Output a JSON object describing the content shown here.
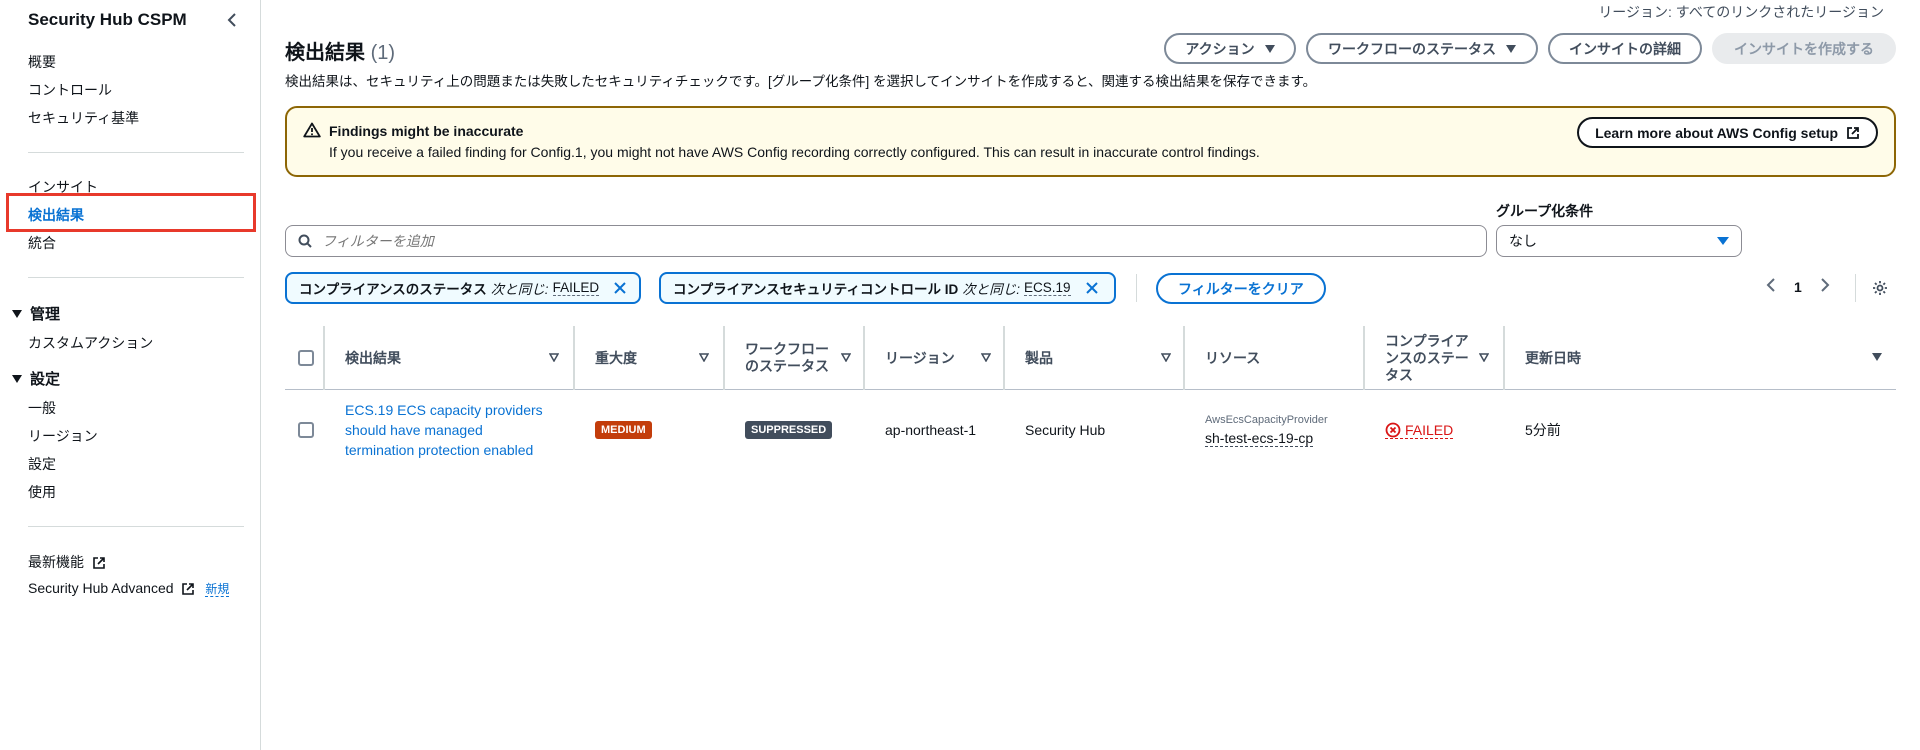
{
  "sidebar": {
    "title": "Security Hub CSPM",
    "nav1": [
      "概要",
      "コントロール",
      "セキュリティ基準"
    ],
    "nav2": [
      "インサイト",
      "検出結果",
      "統合"
    ],
    "section_manage": "管理",
    "manage_items": [
      "カスタムアクション"
    ],
    "section_settings": "設定",
    "settings_items": [
      "一般",
      "リージョン",
      "設定",
      "使用"
    ],
    "latest": "最新機能",
    "advanced": "Security Hub Advanced",
    "new_badge": "新規"
  },
  "header": {
    "region": "リージョン: すべてのリンクされたリージョン",
    "title": "検出結果",
    "count": "(1)",
    "description": "検出結果は、セキュリティ上の問題または失敗したセキュリティチェックです。[グループ化条件] を選択してインサイトを作成すると、関連する検出結果を保存できます。",
    "actions_label": "アクション",
    "workflow_label": "ワークフローのステータス",
    "insight_detail_label": "インサイトの詳細",
    "create_insight_label": "インサイトを作成する"
  },
  "alert": {
    "title": "Findings might be inaccurate",
    "text": "If you receive a failed finding for Config.1, you might not have AWS Config recording correctly configured. This can result in inaccurate control findings.",
    "button": "Learn more about AWS Config setup"
  },
  "filter": {
    "placeholder": "フィルターを追加",
    "group_label": "グループ化条件",
    "group_value": "なし",
    "tokens": [
      {
        "key": "コンプライアンスのステータス",
        "op": "次と同じ:",
        "value": "FAILED"
      },
      {
        "key": "コンプライアンスセキュリティコントロール ID",
        "op": "次と同じ:",
        "value": "ECS.19"
      }
    ],
    "clear": "フィルターをクリア",
    "page": "1"
  },
  "table": {
    "headers": {
      "finding": "検出結果",
      "severity": "重大度",
      "workflow1": "ワークフロー",
      "workflow2": "のステータス",
      "region": "リージョン",
      "product": "製品",
      "resource": "リソース",
      "compliance1": "コンプライア",
      "compliance2": "ンスのステー",
      "compliance3": "タス",
      "updated": "更新日時"
    },
    "rows": [
      {
        "title1": "ECS.19 ECS capacity providers",
        "title2": "should have managed",
        "title3": "termination protection enabled",
        "severity": "MEDIUM",
        "workflow": "SUPPRESSED",
        "region": "ap-northeast-1",
        "product": "Security Hub",
        "resource_type": "AwsEcsCapacityProvider",
        "resource_id": "sh-test-ecs-19-cp",
        "compliance": "FAILED",
        "updated": "5分前"
      }
    ]
  }
}
